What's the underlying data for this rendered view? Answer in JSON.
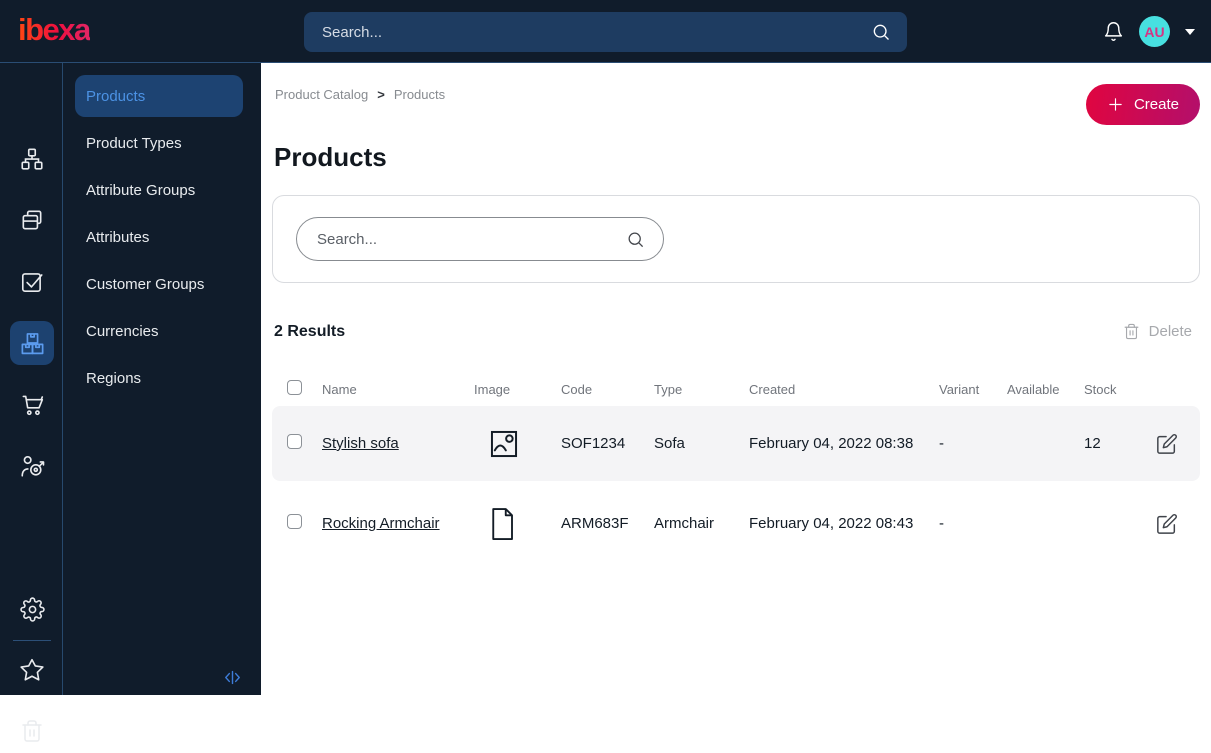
{
  "topbar": {
    "logo_text": "ibexa",
    "search_placeholder": "Search...",
    "avatar_initials": "AU"
  },
  "icon_rail": {
    "items": [
      "content-structure-icon",
      "pages-icon",
      "tasks-icon",
      "product-catalog-icon",
      "commerce-icon",
      "personalization-icon"
    ],
    "active_item": "product-catalog-icon",
    "footer_items": [
      "settings-icon",
      "bookmarks-icon",
      "trash-icon"
    ],
    "collapse_icon": "collapse-sidebar-icon"
  },
  "sidebar": {
    "items": [
      {
        "label": "Products",
        "active": true
      },
      {
        "label": "Product Types",
        "active": false
      },
      {
        "label": "Attribute Groups",
        "active": false
      },
      {
        "label": "Attributes",
        "active": false
      },
      {
        "label": "Customer Groups",
        "active": false
      },
      {
        "label": "Currencies",
        "active": false
      },
      {
        "label": "Regions",
        "active": false
      }
    ]
  },
  "main": {
    "breadcrumb": {
      "items": [
        "Product Catalog",
        "Products"
      ],
      "separator": ">"
    },
    "create_button": "Create",
    "page_title": "Products",
    "filter": {
      "search_placeholder": "Search..."
    },
    "results_summary": "2 Results",
    "delete_button": "Delete",
    "table": {
      "columns": [
        "Name",
        "Image",
        "Code",
        "Type",
        "Created",
        "Variant",
        "Available",
        "Stock"
      ],
      "rows": [
        {
          "name": "Stylish sofa",
          "image_icon": "image-icon",
          "code": "SOF1234",
          "type": "Sofa",
          "created": "February 04, 2022 08:38",
          "variant": "-",
          "available": true,
          "stock": "12"
        },
        {
          "name": "Rocking Armchair",
          "image_icon": "file-icon",
          "code": "ARM683F",
          "type": "Armchair",
          "created": "February 04, 2022 08:43",
          "variant": "-",
          "available": false,
          "stock": ""
        }
      ]
    }
  },
  "colors": {
    "topbar_bg": "#101c2b",
    "topbar_search_bg": "#1e3c61",
    "active_pill_bg": "#1d4372",
    "active_text_blue": "#4c92e4",
    "create_gradient_start": "#e00540",
    "create_gradient_end": "#b30f6b",
    "available_green": "#00a12b",
    "unavailable_gray": "#b3b4b8",
    "avatar_bg": "#47dfe0",
    "avatar_text": "#d63384",
    "row_alt_bg": "#f4f4f6"
  }
}
